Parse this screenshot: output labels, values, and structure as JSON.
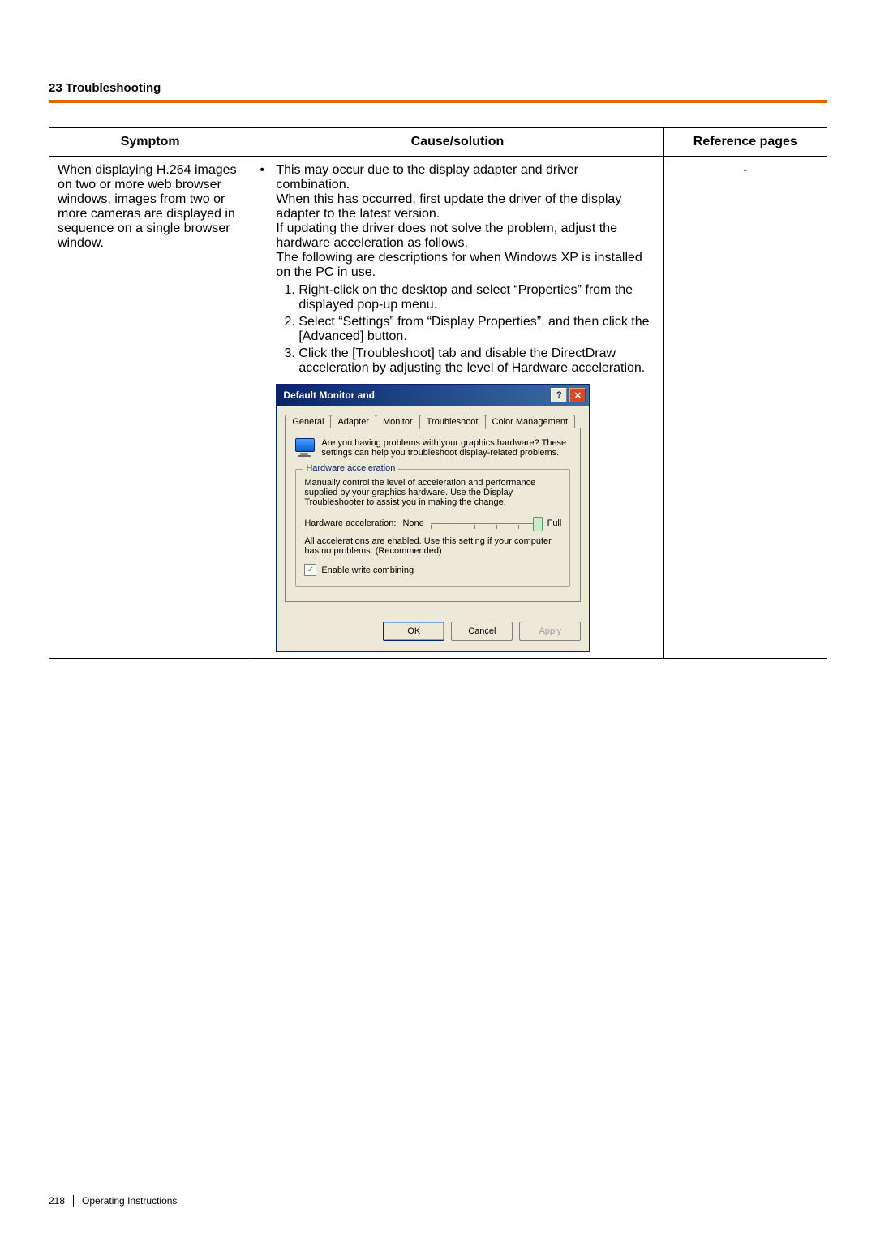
{
  "header": {
    "section_title": "23 Troubleshooting"
  },
  "table": {
    "headers": {
      "symptom": "Symptom",
      "cause": "Cause/solution",
      "ref": "Reference pages"
    },
    "row": {
      "symptom": "When displaying H.264 images on two or more web browser windows, images from two or more cameras are displayed in sequence on a single browser window.",
      "cause_intro": "This may occur due to the display adapter and driver combination.\nWhen this has occurred, first update the driver of the display adapter to the latest version.\nIf updating the driver does not solve the problem, adjust the hardware acceleration as follows.\nThe following are descriptions for when Windows XP is installed on the PC in use.",
      "steps": [
        "Right-click on the desktop and select “Properties” from the displayed pop-up menu.",
        "Select “Settings” from “Display Properties”, and then click the [Advanced] button.",
        "Click the [Troubleshoot] tab and disable the DirectDraw acceleration by adjusting the level of Hardware acceleration."
      ],
      "ref": "-"
    }
  },
  "dialog": {
    "title_prefix": "Default Monitor and",
    "title_rest": "",
    "help_icon": "?",
    "close_icon": "✕",
    "tabs": [
      "General",
      "Adapter",
      "Monitor",
      "Troubleshoot",
      "Color Management"
    ],
    "active_tab_index": 3,
    "intro_text": "Are you having problems with your graphics hardware? These settings can help you troubleshoot display-related problems.",
    "fieldset_legend": "Hardware acceleration",
    "fieldset_desc": "Manually control the level of acceleration and performance supplied by your graphics hardware. Use the Display Troubleshooter to assist you in making the change.",
    "slider_label": "Hardware acceleration:",
    "slider_min": "None",
    "slider_max": "Full",
    "status_text": "All accelerations are enabled. Use this setting if your computer has no problems. (Recommended)",
    "checkbox_label": "Enable write combining",
    "buttons": {
      "ok": "OK",
      "cancel": "Cancel",
      "apply": "Apply"
    }
  },
  "footer": {
    "page_number": "218",
    "doc_title": "Operating Instructions"
  }
}
